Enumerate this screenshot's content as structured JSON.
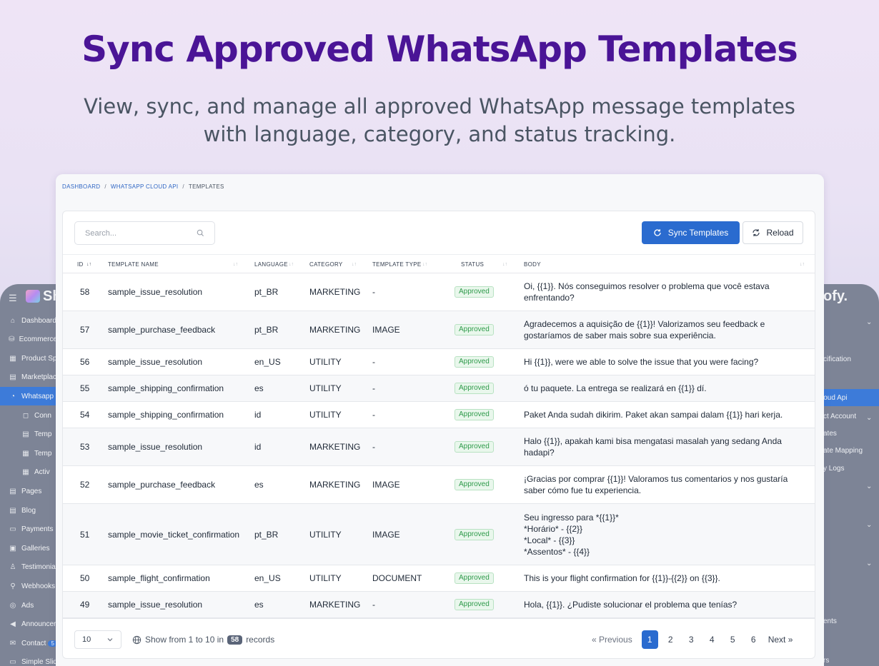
{
  "hero": {
    "title": "Sync Approved WhatsApp Templates",
    "subtitle_line1": "View, sync, and manage all approved WhatsApp message templates",
    "subtitle_line2": "with language, category, and status tracking."
  },
  "background_app": {
    "logo": "Sh",
    "logo_right": "ofy.",
    "sidebar": [
      "Dashboard",
      "Ecommerce",
      "Product Sp",
      "Marketplac",
      "Whatsapp",
      "Conn",
      "Temp",
      "Temp",
      "Activ",
      "Pages",
      "Blog",
      "Payments",
      "Galleries",
      "Testimonia",
      "Webhooks",
      "Ads",
      "Announcer",
      "Contact",
      "Simple Slid"
    ],
    "contact_badge": "5",
    "right_items": [
      "cification",
      "loud Api",
      "ct Account",
      "ates",
      "ate Mapping",
      "y Logs",
      "ents",
      "rs"
    ]
  },
  "breadcrumb": [
    "DASHBOARD",
    "WHATSAPP CLOUD API",
    "TEMPLATES"
  ],
  "toolbar": {
    "search_placeholder": "Search...",
    "sync_label": "Sync Templates",
    "reload_label": "Reload"
  },
  "table": {
    "columns": [
      "ID",
      "TEMPLATE NAME",
      "LANGUAGE",
      "CATEGORY",
      "TEMPLATE TYPE",
      "STATUS",
      "BODY"
    ],
    "rows": [
      {
        "id": "58",
        "name": "sample_issue_resolution",
        "language": "pt_BR",
        "category": "MARKETING",
        "type": "-",
        "status": "Approved",
        "body": [
          "Oi, {{1}}. Nós conseguimos resolver o problema que você estava",
          "enfrentando?"
        ]
      },
      {
        "id": "57",
        "name": "sample_purchase_feedback",
        "language": "pt_BR",
        "category": "MARKETING",
        "type": "IMAGE",
        "status": "Approved",
        "body": [
          "Agradecemos a aquisição de {{1}}! Valorizamos seu feedback e",
          "gostaríamos de saber mais sobre sua experiência."
        ]
      },
      {
        "id": "56",
        "name": "sample_issue_resolution",
        "language": "en_US",
        "category": "UTILITY",
        "type": "-",
        "status": "Approved",
        "body": [
          "Hi {{1}}, were we able to solve the issue that you were facing?"
        ]
      },
      {
        "id": "55",
        "name": "sample_shipping_confirmation",
        "language": "es",
        "category": "UTILITY",
        "type": "-",
        "status": "Approved",
        "body": [
          "ó tu paquete. La entrega se realizará en {{1}} dí."
        ]
      },
      {
        "id": "54",
        "name": "sample_shipping_confirmation",
        "language": "id",
        "category": "UTILITY",
        "type": "-",
        "status": "Approved",
        "body": [
          "Paket Anda sudah dikirim. Paket akan sampai dalam {{1}} hari kerja."
        ]
      },
      {
        "id": "53",
        "name": "sample_issue_resolution",
        "language": "id",
        "category": "MARKETING",
        "type": "-",
        "status": "Approved",
        "body": [
          "Halo {{1}}, apakah kami bisa mengatasi masalah yang sedang Anda",
          "hadapi?"
        ]
      },
      {
        "id": "52",
        "name": "sample_purchase_feedback",
        "language": "es",
        "category": "MARKETING",
        "type": "IMAGE",
        "status": "Approved",
        "body": [
          "¡Gracias por comprar {{1}}! Valoramos tus comentarios y nos gustaría",
          "saber cómo fue tu experiencia."
        ]
      },
      {
        "id": "51",
        "name": "sample_movie_ticket_confirmation",
        "language": "pt_BR",
        "category": "UTILITY",
        "type": "IMAGE",
        "status": "Approved",
        "body": [
          "Seu ingresso para *{{1}}*",
          "*Horário* - {{2}}",
          "*Local* - {{3}}",
          "*Assentos* - {{4}}"
        ]
      },
      {
        "id": "50",
        "name": "sample_flight_confirmation",
        "language": "en_US",
        "category": "UTILITY",
        "type": "DOCUMENT",
        "status": "Approved",
        "body": [
          "This is your flight confirmation for {{1}}-{{2}} on {{3}}."
        ]
      },
      {
        "id": "49",
        "name": "sample_issue_resolution",
        "language": "es",
        "category": "MARKETING",
        "type": "-",
        "status": "Approved",
        "body": [
          "Hola, {{1}}. ¿Pudiste solucionar el problema que tenías?"
        ]
      }
    ]
  },
  "footer": {
    "per_page": "10",
    "show_prefix": "Show from 1 to 10 in",
    "total": "58",
    "records_suffix": "records",
    "prev_label": "« Previous",
    "pages": [
      "1",
      "2",
      "3",
      "4",
      "5",
      "6"
    ],
    "current_page": "1",
    "next_label": "Next »"
  },
  "colors": {
    "accent": "#2a6bcf",
    "title": "#4a1496",
    "approved": "#2e9a4a"
  }
}
